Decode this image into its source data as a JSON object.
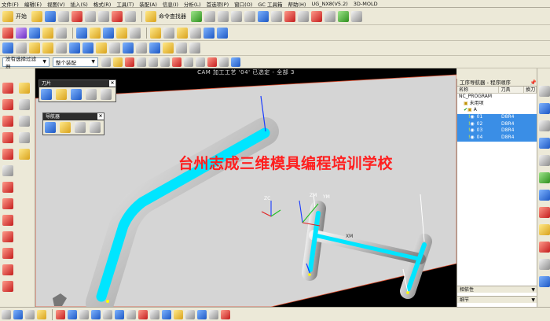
{
  "menubar": {
    "items": [
      "文件(F)",
      "编辑(E)",
      "视图(V)",
      "插入(S)",
      "格式(R)",
      "工具(T)",
      "装配(A)",
      "信息(I)",
      "分析(L)",
      "首选项(P)",
      "窗口(O)",
      "GC 工具箱",
      "帮助(H)",
      "UG_NX8(V5.2)",
      "3D-MOLD"
    ]
  },
  "toolbar": {
    "start_label": "开始",
    "cmd_finder_label": "命令查找器",
    "filter_dropdown": "没有选择过滤器",
    "assembly_dropdown": "整个装配"
  },
  "viewport": {
    "title": "CAM 加工工艺 '04' 已选定 - 全部 3",
    "watermark": "台州志成三维模具编程培训学校",
    "triad_label": "ZC",
    "axis_labels": [
      "ZM",
      "YM",
      "XM"
    ]
  },
  "floating_toolbars": {
    "tool_panel_title": "刀片",
    "nav_panel_title": "导航器"
  },
  "navigator": {
    "title": "工序导航器 - 程序顺序",
    "columns": [
      "名称",
      "刀具",
      "换刀"
    ],
    "rows": [
      {
        "name": "NC_PROGRAM",
        "tool": "",
        "indent": 0,
        "selected": false
      },
      {
        "name": "未用项",
        "tool": "",
        "indent": 1,
        "selected": false
      },
      {
        "name": "A",
        "tool": "",
        "indent": 1,
        "selected": false
      },
      {
        "name": "01",
        "tool": "D8R4",
        "indent": 2,
        "selected": true
      },
      {
        "name": "02",
        "tool": "D8R4",
        "indent": 2,
        "selected": true
      },
      {
        "name": "03",
        "tool": "D8R4",
        "indent": 2,
        "selected": true
      },
      {
        "name": "04",
        "tool": "D8R4",
        "indent": 2,
        "selected": true
      }
    ],
    "dependencies_label": "相依性",
    "details_label": "细节"
  },
  "colors": {
    "cyan_path": "#00e5ff",
    "selection": "#3a8ee6",
    "watermark": "#ff1f1f"
  }
}
